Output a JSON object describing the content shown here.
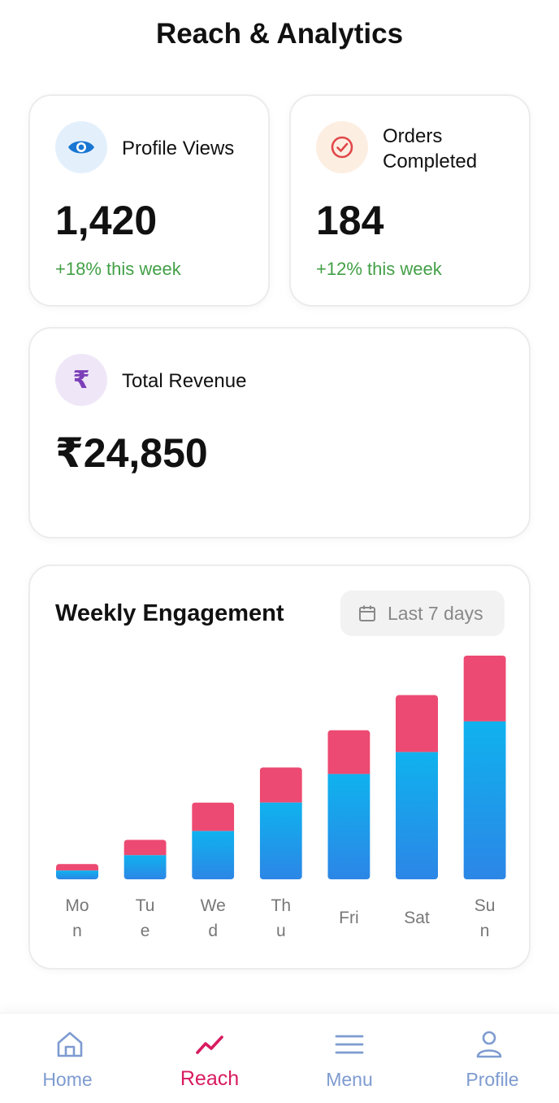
{
  "header": {
    "title": "Reach & Analytics"
  },
  "stats": {
    "profile_views": {
      "label": "Profile Views",
      "value": "1,420",
      "delta": "+18% this week",
      "icon": "eye-icon"
    },
    "orders_completed": {
      "label_line1": "Orders",
      "label_line2": "Completed",
      "value": "184",
      "delta": "+12% this week",
      "icon": "check-circle-icon"
    },
    "total_revenue": {
      "label": "Total Revenue",
      "value": "₹24,850",
      "icon": "rupee-icon",
      "icon_glyph": "₹"
    }
  },
  "engagement": {
    "title": "Weekly Engagement",
    "range_label": "Last 7 days",
    "range_icon": "calendar-icon"
  },
  "chart_data": {
    "type": "bar",
    "stacked": true,
    "title": "Weekly Engagement",
    "categories": [
      "Mon",
      "Tue",
      "Wed",
      "Thu",
      "Fri",
      "Sat",
      "Sun"
    ],
    "tick_labels": [
      [
        "Mo",
        "n"
      ],
      [
        "Tu",
        "e"
      ],
      [
        "We",
        "d"
      ],
      [
        "Th",
        "u"
      ],
      [
        "Fri"
      ],
      [
        "Sat"
      ],
      [
        "Su",
        "n"
      ]
    ],
    "series": [
      {
        "values": [
          4,
          11,
          22,
          35,
          48,
          58,
          72
        ],
        "color": "#1e9be8"
      },
      {
        "values": [
          3,
          7,
          13,
          16,
          20,
          26,
          30
        ],
        "color": "#ec4a72"
      }
    ],
    "ylim": [
      0,
      102
    ],
    "grid": false,
    "legend": "none"
  },
  "nav": {
    "items": [
      {
        "label": "Home",
        "icon": "home-icon",
        "active": false
      },
      {
        "label": "Reach",
        "icon": "trending-up-icon",
        "active": true
      },
      {
        "label": "Menu",
        "icon": "menu-icon",
        "active": false
      },
      {
        "label": "Profile",
        "icon": "profile-icon",
        "active": false
      }
    ]
  },
  "colors": {
    "accent": "#d81b60",
    "positive": "#43a047",
    "nav_inactive": "#7e9bd0",
    "bar_bottom": "#1e9be8",
    "bar_top": "#ec4a72"
  }
}
